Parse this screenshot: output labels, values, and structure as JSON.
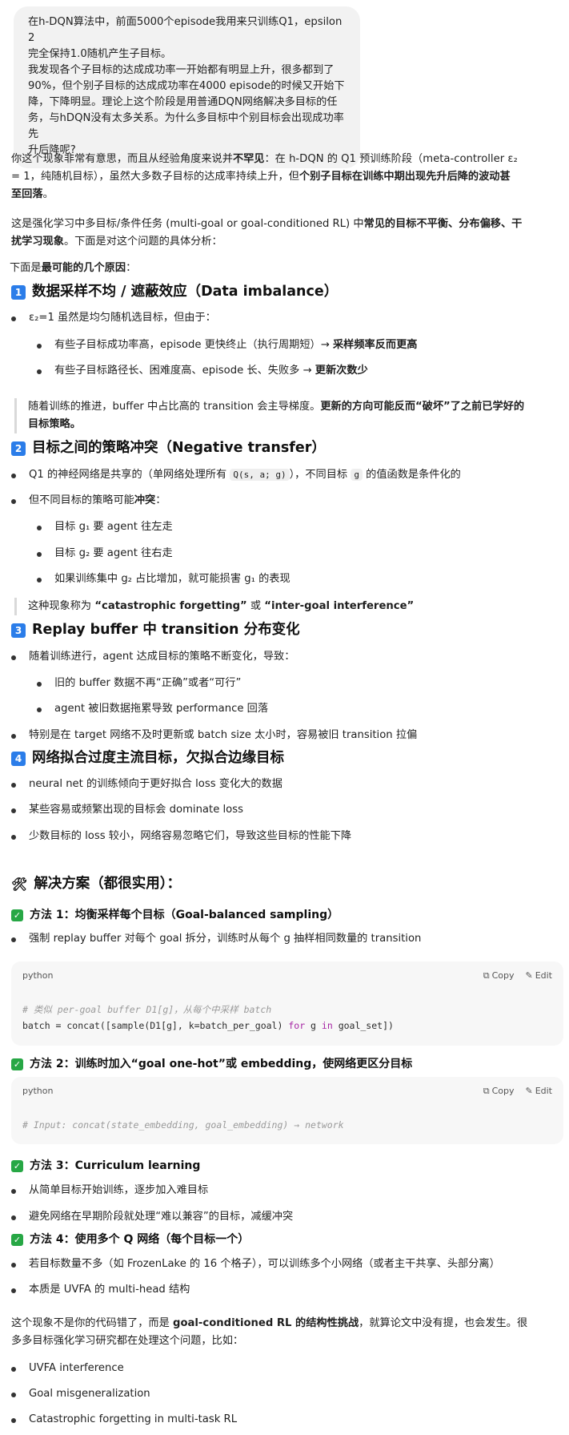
{
  "user_message": {
    "lines": [
      "在h-DQN算法中，前面5000个episode我用来只训练Q1，epsilon 2",
      "完全保持1.0随机产生子目标。",
      "我发现各个子目标的达成成功率一开始都有明显上升，很多都到了",
      "90%，但个别子目标的达成成功率在4000 episode的时候又开始下",
      "降，下降明显。理论上这个阶段是用普通DQN网络解决多目标的任",
      "务，与hDQN没有太多关系。为什么多目标中个别目标会出现成功率先",
      "升后降呢?"
    ]
  },
  "intro": {
    "p1_a": "你这个现象非常有意思，而且从经验角度来说并",
    "p1_bold": "不罕见",
    "p1_b": "：在 h-DQN 的 Q1 预训练阶段（meta-controller ε₂",
    "p1_line2_a": "= 1，纯随机目标），虽然大多数子目标的达成率持续上升，但",
    "p1_line2_bold": "个别子目标在训练中期出现先升后降的波动甚",
    "p1_line3_bold": "至回落",
    "p1_line3_b": "。",
    "p2_a": "这是强化学习中多目标/条件任务 (multi-goal or goal-conditioned RL) 中",
    "p2_bold": "常见的目标不平衡、分布偏移、干",
    "p2_line2_bold": "扰学习现象",
    "p2_line2_b": "。下面是对这个问题的具体分析：",
    "p3_a": "下面是",
    "p3_bold": "最可能的几个原因",
    "p3_b": "："
  },
  "section1": {
    "badge": "1",
    "title": "数据采样不均 / 遮蔽效应（Data imbalance）",
    "bullet1": "ε₂=1 虽然是均匀随机选目标，但由于：",
    "sub1_a": "有些子目标成功率高，episode 更快终止（执行周期短）→",
    "sub1_bold": "采样频率反而更高",
    "sub2_a": "有些子目标路径长、困难度高、episode 长、失败多 →",
    "sub2_bold": "更新次数少",
    "quote_a": "随着训练的推进，buffer 中占比高的 transition 会主导梯度。",
    "quote_bold": "更新的方向可能反而“破坏”了之前已学好的",
    "quote_line2_bold": "目标策略。"
  },
  "section2": {
    "badge": "2",
    "title": "目标之间的策略冲突（Negative transfer）",
    "bullet1_a": "Q1 的神经网络是共享的（单网络处理所有",
    "bullet1_code": "Q(s, a; g)",
    "bullet1_b": "），不同目标",
    "bullet1_code2": "g",
    "bullet1_c": "的值函数是条件化的",
    "bullet2_a": "但不同目标的策略可能",
    "bullet2_bold": "冲突",
    "bullet2_b": "：",
    "sub1": "目标 g₁ 要 agent 往左走",
    "sub2": "目标 g₂ 要 agent 往右走",
    "sub3": "如果训练集中 g₂ 占比增加，就可能损害 g₁ 的表现",
    "quote_a": "这种现象称为 ",
    "quote_bold1": "“catastrophic forgetting”",
    "quote_b": " 或 ",
    "quote_bold2": "“inter-goal interference”"
  },
  "section3": {
    "badge": "3",
    "title": "Replay buffer 中 transition 分布变化",
    "bullet1": "随着训练进行，agent 达成目标的策略不断变化，导致：",
    "sub1": "旧的 buffer 数据不再“正确”或者“可行”",
    "sub2": "agent 被旧数据拖累导致 performance 回落",
    "bullet2": "特别是在 target 网络不及时更新或 batch size 太小时，容易被旧 transition 拉偏"
  },
  "section4": {
    "badge": "4",
    "title": "网络拟合过度主流目标，欠拟合边缘目标",
    "bullet1": "neural net 的训练倾向于更好拟合 loss 变化大的数据",
    "bullet2": "某些容易或频繁出现的目标会 dominate loss",
    "bullet3": "少数目标的 loss 较小，网络容易忽略它们，导致这些目标的性能下降"
  },
  "solutions": {
    "title": "解决方案（都很实用）：",
    "m1_title": "方法 1：均衡采样每个目标（Goal-balanced sampling）",
    "m1_bullet": "强制 replay buffer 对每个 goal 拆分，训练时从每个 g 抽样相同数量的 transition",
    "code1": {
      "lang": "python",
      "copy": "Copy",
      "edit": "Edit",
      "line1": "# 类似 per-goal buffer D1[g]，从每个中采样 batch",
      "line2_a": "batch = concat([sample(D1[g], k=batch_per_goal) ",
      "line2_kw1": "for",
      "line2_b": " g ",
      "line2_kw2": "in",
      "line2_c": " goal_set])"
    },
    "m2_title": "方法 2：训练时加入“goal one-hot”或 embedding，使网络更区分目标",
    "code2": {
      "lang": "python",
      "copy": "Copy",
      "edit": "Edit",
      "line1": "# Input: concat(state_embedding, goal_embedding) → network"
    },
    "m3_title": "方法 3：Curriculum learning",
    "m3_b1": "从简单目标开始训练，逐步加入难目标",
    "m3_b2": "避免网络在早期阶段就处理“难以兼容”的目标，减缓冲突",
    "m4_title": "方法 4：使用多个 Q 网络（每个目标一个）",
    "m4_b1": "若目标数量不多（如 FrozenLake 的 16 个格子），可以训练多个小网络（或者主干共享、头部分离）",
    "m4_b2": "本质是 UVFA 的 multi-head 结构"
  },
  "conclusion": {
    "p_a": "这个现象不是你的代码错了，而是 ",
    "p_bold": "goal-conditioned RL 的结构性挑战",
    "p_b": "，就算论文中没有提，也会发生。很",
    "p_line2": "多多目标强化学习研究都在处理这个问题，比如：",
    "b1": "UVFA interference",
    "b2": "Goal misgeneralization",
    "b3": "Catastrophic forgetting in multi-task RL"
  }
}
